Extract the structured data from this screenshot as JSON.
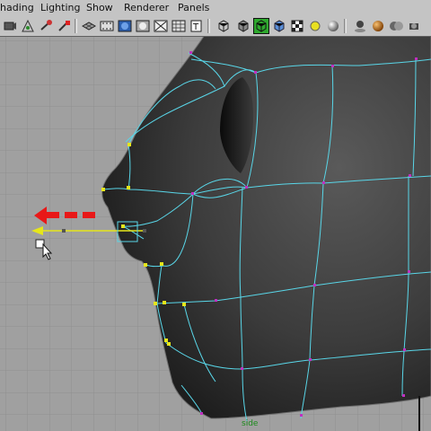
{
  "menus": [
    {
      "label": "hading"
    },
    {
      "label": "Lighting"
    },
    {
      "label": "Show"
    },
    {
      "label": "Renderer"
    },
    {
      "label": "Panels"
    }
  ],
  "toolbar": {
    "icons": [
      "camera-select-icon",
      "camera-attributes-icon",
      "bookmark-icon",
      "image-plane-icon",
      "grid-icon",
      "film-gate-icon",
      "resolution-gate-icon",
      "gate-mask-icon",
      "wireframe-icon",
      "smooth-shade-icon",
      "wireframe-on-shaded-icon",
      "x-ray-icon",
      "default-lighting-icon",
      "use-all-lights-icon",
      "textured-icon",
      "display-textures-icon",
      "isolate-select-icon",
      "lights-icon",
      "shadows-icon",
      "high-quality-icon"
    ]
  },
  "viewport": {
    "camera_label": "side",
    "background_color": "#a0a0a0",
    "model_color": "#3a3a3a",
    "edge_color": "#59d6e8",
    "vertex_color": "#e6e61a",
    "arrow_color": "#e81818"
  }
}
